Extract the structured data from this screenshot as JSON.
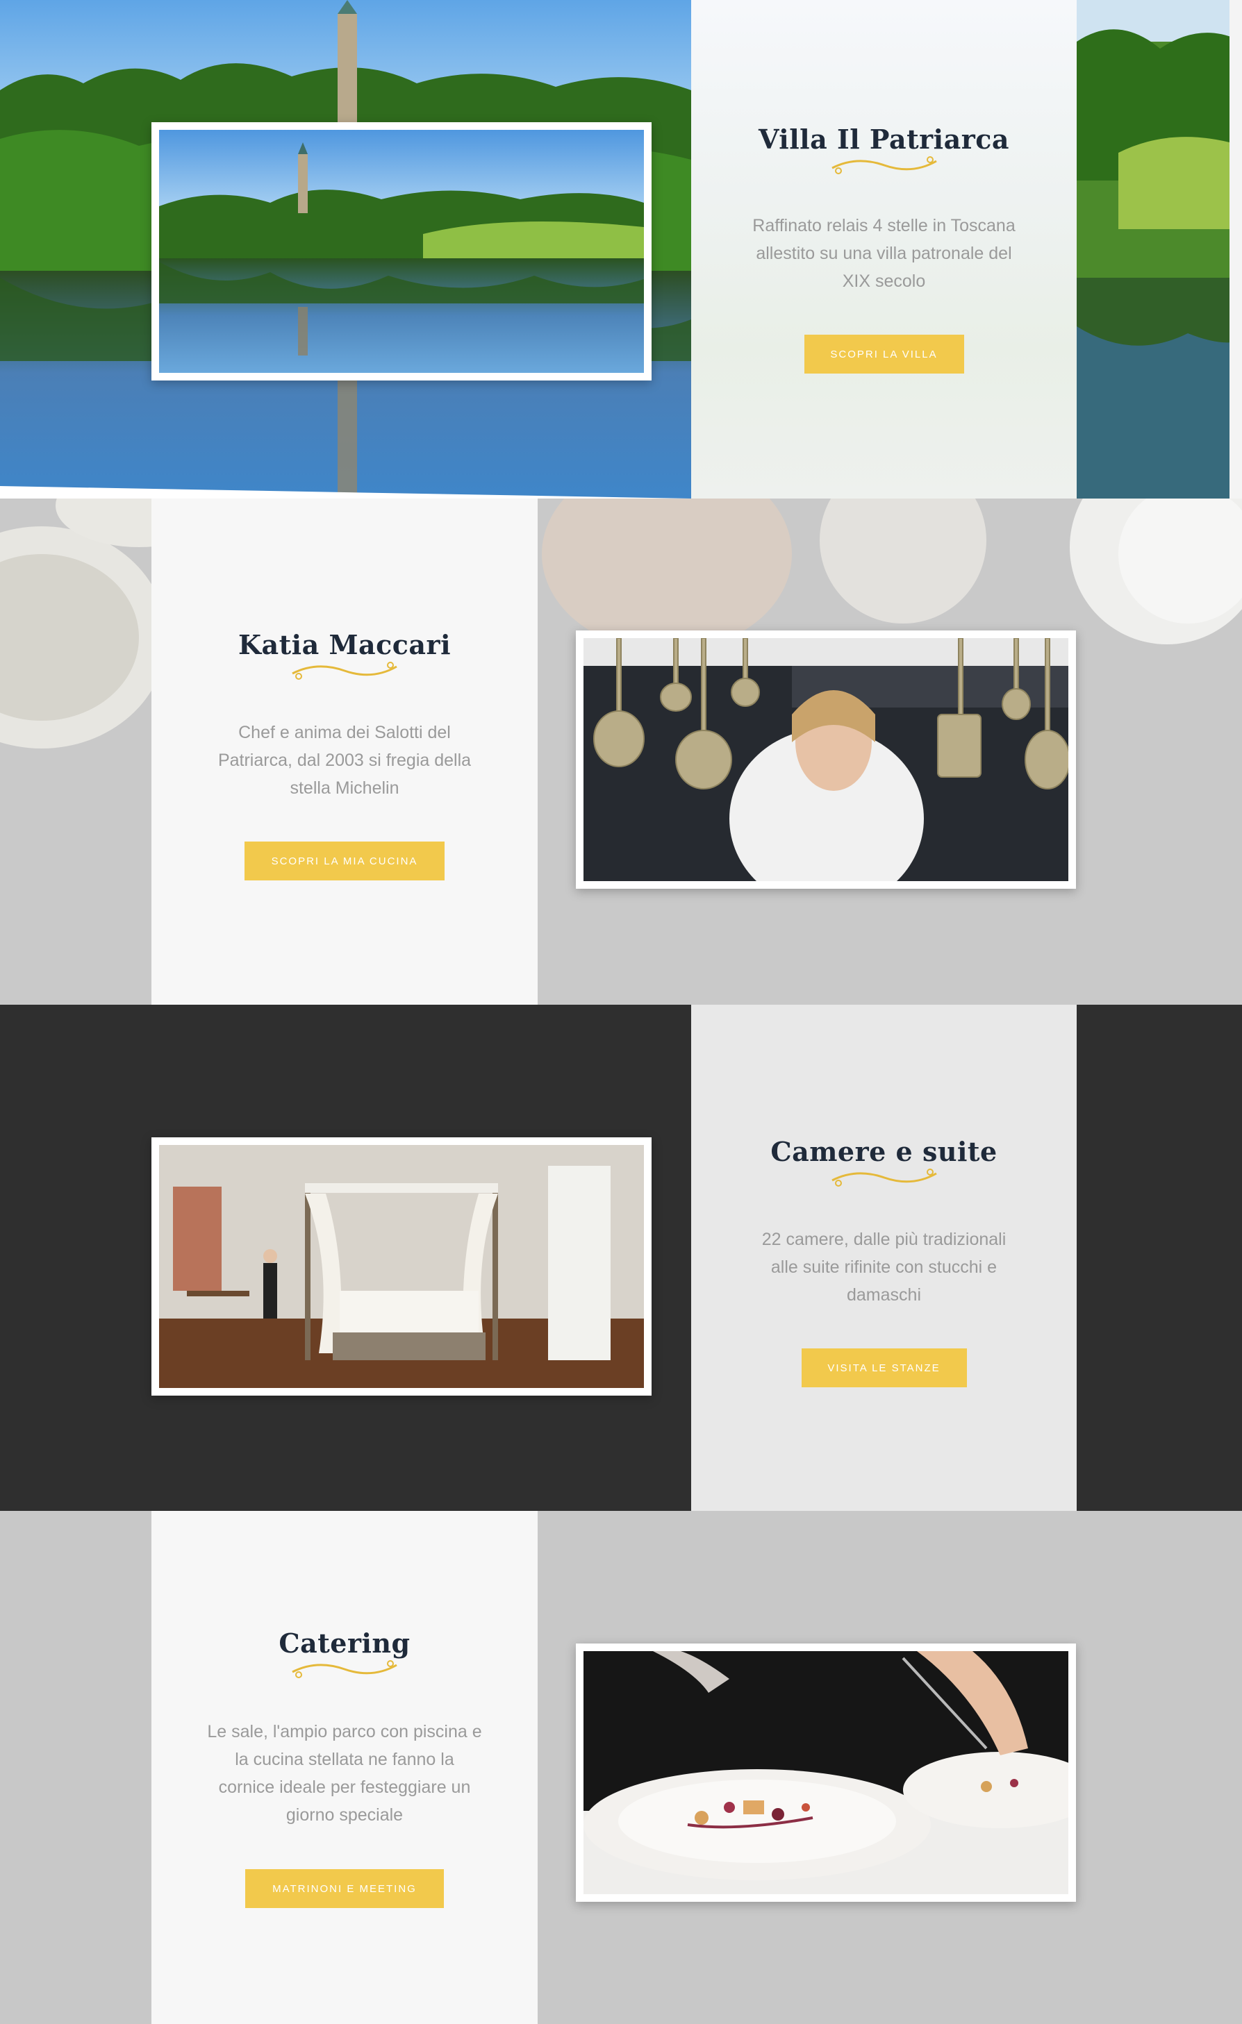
{
  "sections": [
    {
      "id": "villa",
      "title": "Villa Il Patriarca",
      "text_lines": [
        "Raffinato relais 4 stelle in Toscana",
        "allestito su una villa patronale del",
        "XIX secolo"
      ],
      "button": "SCOPRI LA VILLA",
      "image": "lake-castle-photo"
    },
    {
      "id": "chef",
      "title": "Katia Maccari",
      "text_lines": [
        "Chef e anima dei Salotti del",
        "Patriarca, dal 2003 si fregia della",
        "stella Michelin"
      ],
      "button": "SCOPRI LA MIA CUCINA",
      "image": "chef-kitchen-photo"
    },
    {
      "id": "rooms",
      "title": "Camere e suite",
      "text_lines": [
        "22 camere, dalle più tradizionali",
        "alle suite rifinite con stucchi e",
        "damaschi"
      ],
      "button": "VISITA LE STANZE",
      "image": "bedroom-photo"
    },
    {
      "id": "catering",
      "title": "Catering",
      "text_lines": [
        "Le sale, l'ampio parco con piscina e",
        "la cucina stellata ne fanno la",
        "cornice ideale per festeggiare un",
        "giorno speciale"
      ],
      "button": "MATRINONI E MEETING",
      "image": "plated-dish-photo"
    }
  ],
  "scroll_top_icon": "chevron-up-icon",
  "colors": {
    "accent": "#f2c94c",
    "title": "#1f2a3a",
    "body_text": "#9a9a9a",
    "dark_band": "#2f2f2f",
    "grey_band": "#c9c9c9"
  }
}
